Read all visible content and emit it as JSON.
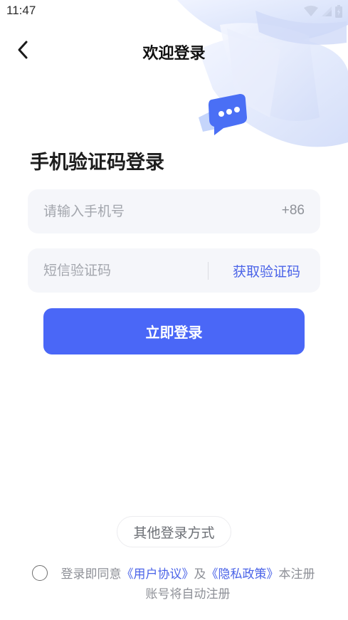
{
  "status": {
    "time": "11:47"
  },
  "nav": {
    "title": "欢迎登录"
  },
  "page": {
    "title": "手机验证码登录"
  },
  "phone": {
    "placeholder": "请输入手机号",
    "value": "",
    "prefix": "+86"
  },
  "code": {
    "placeholder": "短信验证码",
    "value": "",
    "get_label": "获取验证码"
  },
  "login_button": "立即登录",
  "other_login": "其他登录方式",
  "agreement": {
    "checked": false,
    "prefix": "登录即同意",
    "user_agreement": "《用户协议》",
    "and": "及",
    "privacy_policy": "《隐私政策》",
    "suffix": "本注册账号将自动注册"
  },
  "colors": {
    "primary": "#4a67f7",
    "link": "#4a63e8",
    "field_bg": "#f5f6fa"
  }
}
